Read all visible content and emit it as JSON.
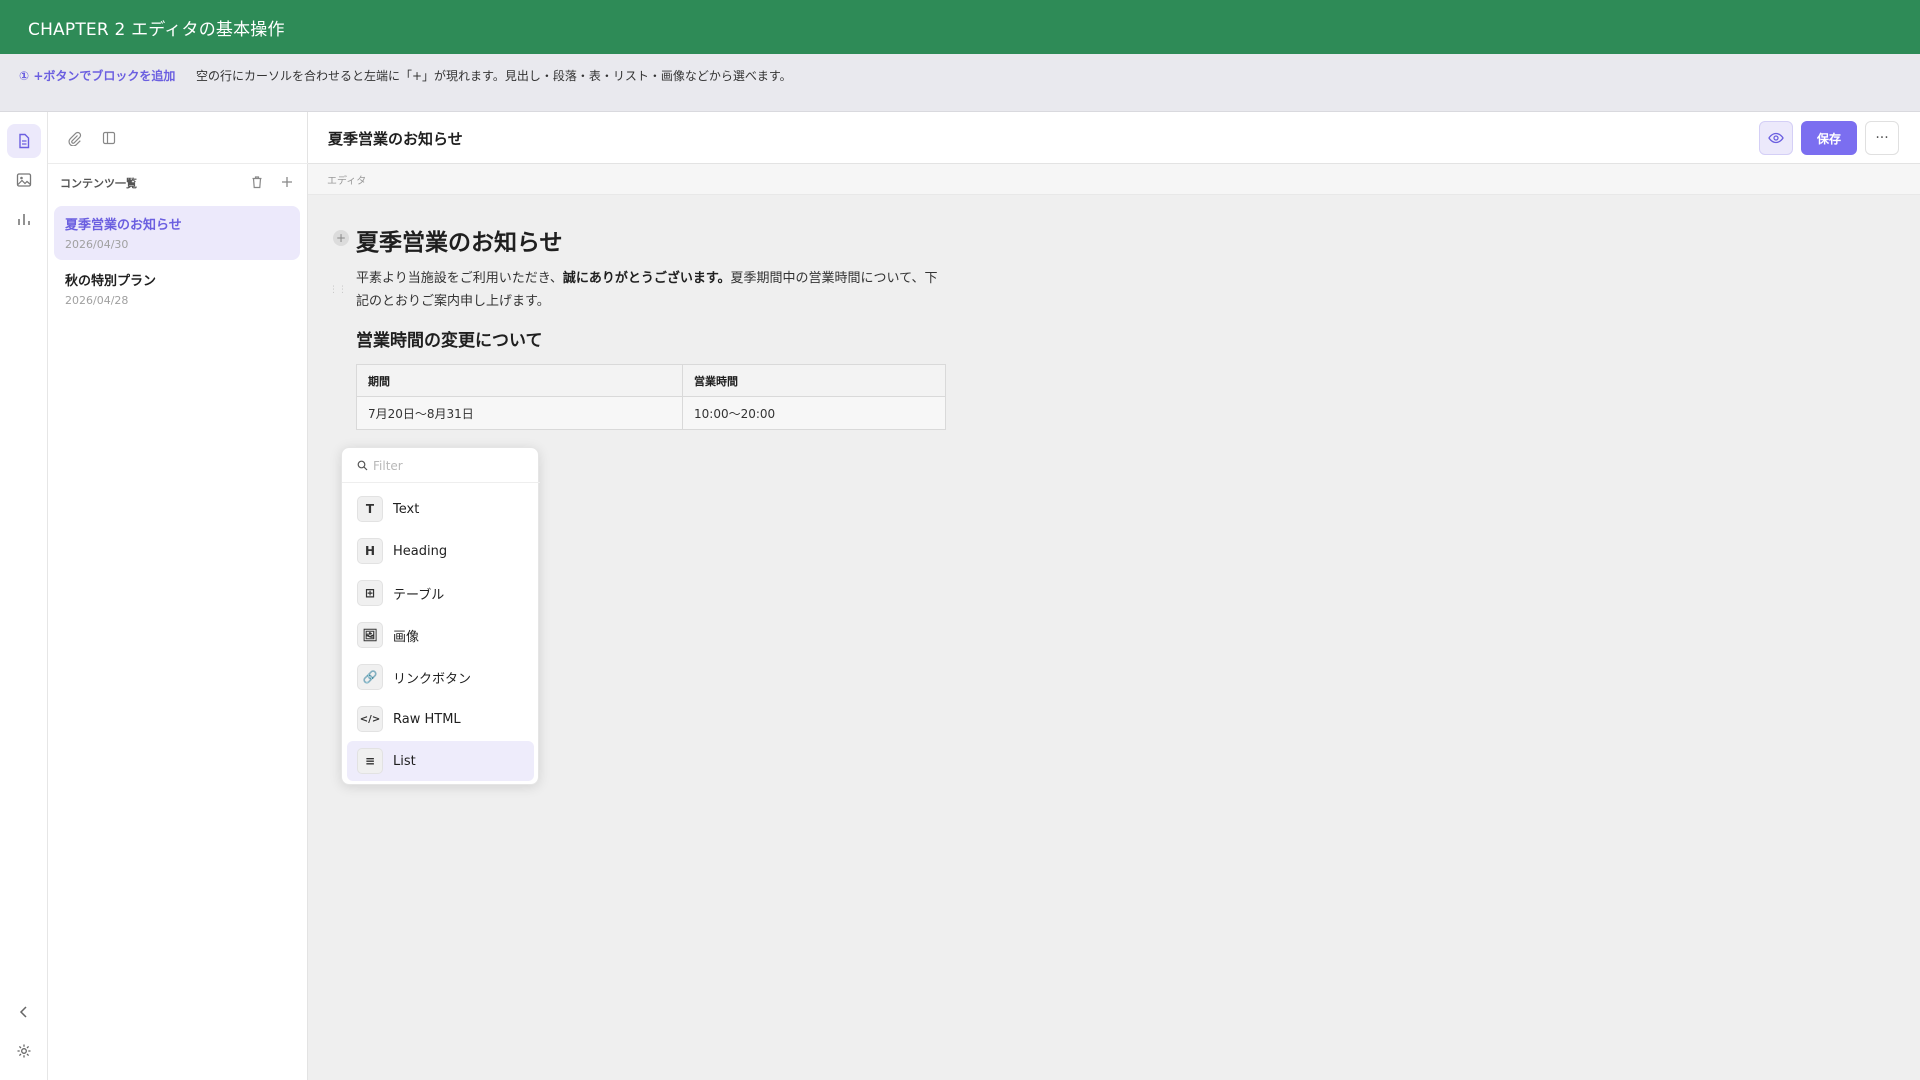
{
  "topbar": {
    "title": "CHAPTER 2 エディタの基本操作"
  },
  "hint": {
    "title": "① +ボタンでブロックを追加",
    "text": "空の行にカーソルを合わせると左端に「+」が現れます。見出し・段落・表・リスト・画像などから選べます。"
  },
  "rail": {
    "items": [
      "document-icon",
      "image-icon",
      "chart-icon"
    ],
    "bottom": [
      "collapse-icon",
      "gear-icon"
    ]
  },
  "sidebar": {
    "tools": [
      "paperclip-icon",
      "panel-icon"
    ],
    "section_label": "コンテンツ一覧",
    "docs": [
      {
        "title": "夏季営業のお知らせ",
        "date": "2026/04/30"
      },
      {
        "title": "秋の特別プラン",
        "date": "2026/04/28"
      }
    ]
  },
  "header": {
    "doc_title": "夏季営業のお知らせ",
    "save_label": "保存",
    "more_label": "···"
  },
  "editor": {
    "label": "エディタ",
    "h1": "夏季営業のお知らせ",
    "para_before": "平素より当施設をご利用いただき、",
    "para_bold": "誠にありがとうございます。",
    "para_after": "夏季期間中の営業時間について、下記のとおりご案内申し上げます。",
    "h2": "営業時間の変更について",
    "table": {
      "headers": [
        "期間",
        "営業時間"
      ],
      "rows": [
        [
          "7月20日〜8月31日",
          "10:00〜20:00"
        ]
      ]
    }
  },
  "menu": {
    "filter_placeholder": "Filter",
    "items": [
      {
        "icon": "T",
        "label": "Text"
      },
      {
        "icon": "H",
        "label": "Heading"
      },
      {
        "icon": "⊞",
        "label": "テーブル"
      },
      {
        "icon": "🖼",
        "label": "画像"
      },
      {
        "icon": "🔗",
        "label": "リンクボタン"
      },
      {
        "icon": "</>",
        "label": "Raw HTML"
      },
      {
        "icon": "≡",
        "label": "List"
      }
    ]
  },
  "colors": {
    "topbar": "#2e8b57",
    "accent": "#7b6ef0",
    "accent_soft": "#ece9fb"
  }
}
